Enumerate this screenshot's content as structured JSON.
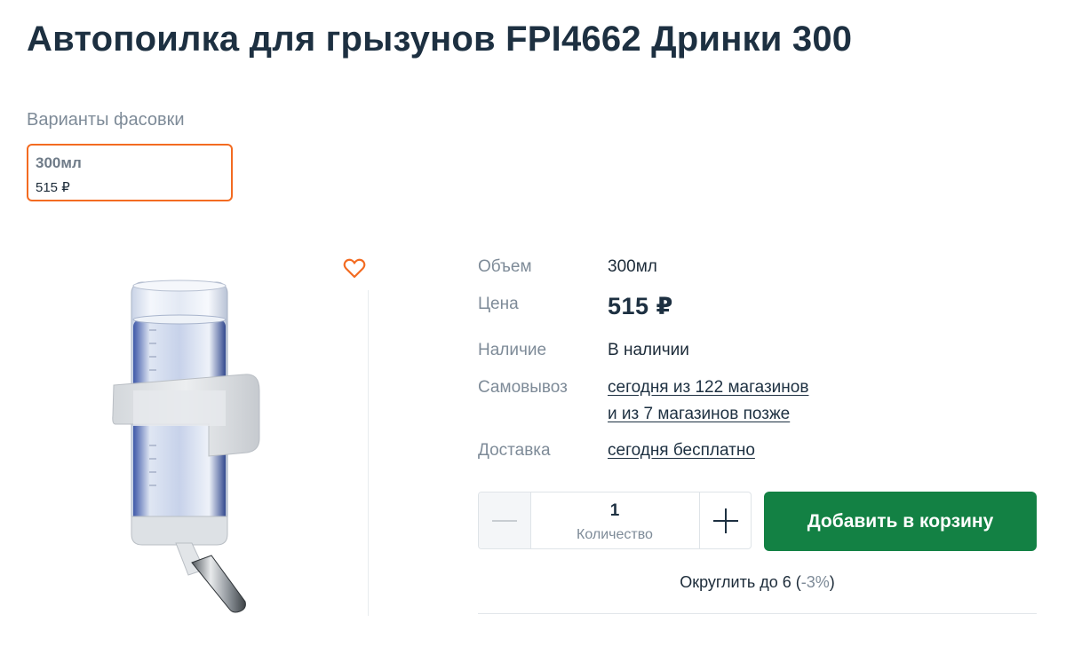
{
  "page": {
    "title": "Автопоилка для грызунов FPI4662 Дринки 300"
  },
  "variants": {
    "label": "Варианты фасовки",
    "items": [
      {
        "name": "300мл",
        "price": "515 ₽",
        "selected": true
      }
    ]
  },
  "product_image": {
    "alt": "Автопоилка для грызунов",
    "favorite_icon": "heart-outline-icon"
  },
  "specs": {
    "volume_label": "Объем",
    "volume_value": "300мл",
    "price_label": "Цена",
    "price_value": "515 ₽",
    "stock_label": "Наличие",
    "stock_value": "В наличии",
    "pickup_label": "Самовывоз",
    "pickup_line1": "сегодня из 122 магазинов",
    "pickup_line2": "и из 7 магазинов позже",
    "delivery_label": "Доставка",
    "delivery_value": "сегодня бесплатно"
  },
  "quantity": {
    "value": "1",
    "label": "Количество"
  },
  "cart": {
    "add_label": "Добавить в корзину"
  },
  "rounding": {
    "prefix": "Округлить до 6 (",
    "discount": "-3%",
    "suffix": ")"
  },
  "colors": {
    "accent": "#f36b21",
    "primary_button": "#138144",
    "heading": "#1d3041",
    "muted": "#7e8b98"
  }
}
